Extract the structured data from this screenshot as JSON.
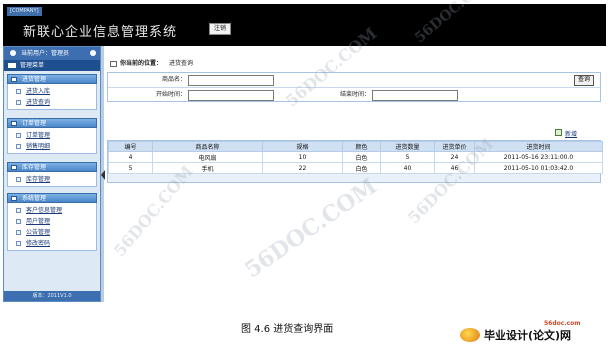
{
  "header": {
    "company_tag": "[COMPANY]",
    "app_title": "新联心企业信息管理系统",
    "logout_label": "注销"
  },
  "sidebar": {
    "current_user": "当前用户：管理员",
    "menu_title": "管理菜单",
    "groups": [
      {
        "title": "进货管理",
        "items": [
          {
            "label": "进货入库"
          },
          {
            "label": "进货查询"
          }
        ]
      },
      {
        "title": "订单管理",
        "items": [
          {
            "label": "订单管理"
          },
          {
            "label": "销售明细"
          }
        ]
      },
      {
        "title": "库存管理",
        "items": [
          {
            "label": "库存管理"
          }
        ]
      },
      {
        "title": "系统管理",
        "items": [
          {
            "label": "客户信息管理"
          },
          {
            "label": "用户管理"
          },
          {
            "label": "公告管理"
          },
          {
            "label": "修改密码"
          }
        ]
      }
    ],
    "version": "版本：2011V1.0"
  },
  "main": {
    "location_label": "你当前的位置：",
    "location_page": "进货查询",
    "search": {
      "product_name_label": "商品名：",
      "product_name_value": "",
      "start_time_label": "开始时间：",
      "start_time_value": "",
      "end_time_label": "结束时间：",
      "end_time_value": "",
      "search_button": "查询"
    },
    "add_label": "新增",
    "table": {
      "columns": [
        "编号",
        "商品名称",
        "规格",
        "颜色",
        "进货数量",
        "进货单价",
        "进货时间"
      ],
      "rows": [
        [
          "4",
          "电风扇",
          "10",
          "白色",
          "5",
          "24",
          "2011-05-16 23:11:00.0"
        ],
        [
          "5",
          "手机",
          "22",
          "白色",
          "40",
          "46",
          "2011-05-10 01:03:42.0"
        ]
      ]
    }
  },
  "caption": "图 4.6 进货查询界面",
  "watermark_text": "56DOC.COM",
  "brand": {
    "url": "56doc.com",
    "name": "毕业设计(论文)网"
  }
}
